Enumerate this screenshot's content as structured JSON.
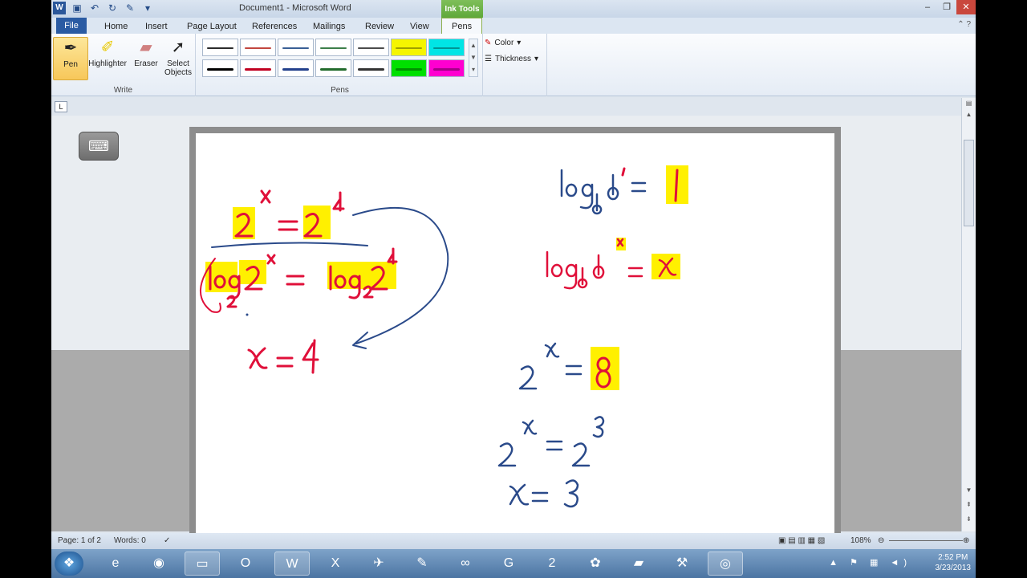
{
  "window": {
    "title": "Document1  -  Microsoft Word",
    "context_tab_group": "Ink Tools",
    "controls": [
      "–",
      "❐",
      "✕"
    ]
  },
  "tabs": {
    "file": "File",
    "items": [
      "Home",
      "Insert",
      "Page Layout",
      "References",
      "Mailings",
      "Review",
      "View"
    ],
    "active": "Pens",
    "right": "⌃ ?"
  },
  "ribbon": {
    "write": {
      "label": "Write",
      "pen": "Pen",
      "highlighter": "Highlighter",
      "eraser": "Eraser",
      "select_objects_line1": "Select",
      "select_objects_line2": "Objects"
    },
    "pens": {
      "label": "Pens",
      "colors_row1": [
        "#2b2b2b",
        "#c2463e",
        "#3a5f95",
        "#3d7f4a",
        "#4b4b4b",
        "#f5f500",
        "#00e5e5"
      ],
      "colors_row2": [
        "#000000",
        "#c00020",
        "#23408c",
        "#226b2c",
        "#333333",
        "#00e000",
        "#ff00d0"
      ]
    },
    "color_btn": "Color",
    "thickness_btn": "Thickness"
  },
  "ruler": {
    "tab_selector": "L"
  },
  "document": {
    "keyboard_icon": "keyboard-icon",
    "ink_accent": "#e0103a",
    "ink_blue": "#2a4a8a",
    "highlight": "#fff000"
  },
  "status": {
    "page": "Page: 1 of 2",
    "words": "Words: 0",
    "zoom": "108%"
  },
  "taskbar": {
    "time": "2:52 PM",
    "date": "3/23/2013"
  }
}
